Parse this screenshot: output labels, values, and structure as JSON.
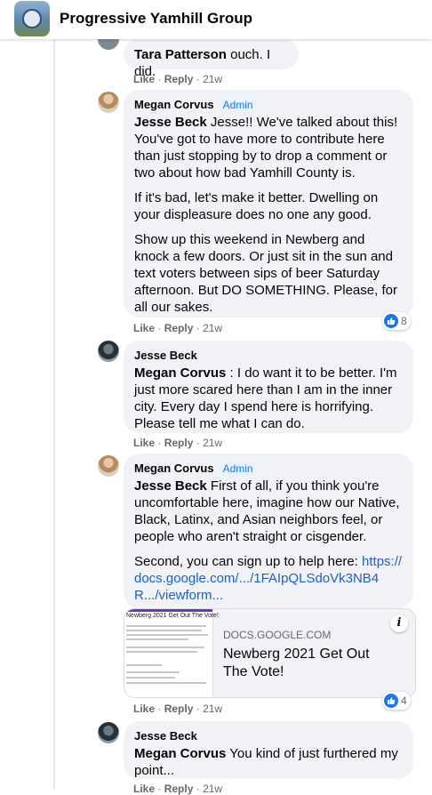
{
  "header": {
    "group_name": "Progressive Yamhill Group"
  },
  "action_labels": {
    "like": "Like",
    "reply": "Reply",
    "separator": "·"
  },
  "comments": [
    {
      "author": "Tara Patterson",
      "text": "ouch. I did.",
      "time": "21w"
    },
    {
      "author": "Megan Corvus",
      "badge": "Admin",
      "mention": "Jesse Beck",
      "paragraphs": [
        "Jesse!! We've talked about this! You've got to have more to contribute here than just stopping by to drop a comment or two about how bad Yamhill County is.",
        "If it's bad, let's make it better. Dwelling on your displeasure does no one any good.",
        "Show up this weekend in Newberg and knock a few doors. Or just sit in the sun and text voters between sips of beer Saturday afternoon. But DO SOMETHING. Please, for all our sakes."
      ],
      "time": "21w",
      "reactions": "8"
    },
    {
      "author": "Jesse Beck",
      "mention": "Megan Corvus",
      "text": ": I do want it to be better. I'm just more scared here than I am in the inner city. Every day I spend here is horrifying. Please tell me what I can do.",
      "time": "21w"
    },
    {
      "author": "Megan Corvus",
      "badge": "Admin",
      "mention": "Jesse Beck",
      "paragraph1": "First of all, if you think you're uncomfortable here, imagine how our Native, Black, Latinx, and Asian neighbors feel, or people who aren't straight or cisgender.",
      "paragraph2": "Second, you can sign up to help here:",
      "link": "https://docs.google.com/.../1FAIpQLSdoVk3NB4R.../viewform...",
      "card": {
        "domain": "DOCS.GOOGLE.COM",
        "title": "Newberg 2021 Get Out The Vote!",
        "thumb_title": "Newberg 2021 Get Out The Vote!"
      },
      "time": "21w",
      "reactions": "4"
    },
    {
      "author": "Jesse Beck",
      "mention": "Megan Corvus",
      "text": "You kind of just furthered my point...",
      "time": "21w"
    }
  ],
  "colors": {
    "accent": "#1877f2",
    "link": "#1a62c9",
    "bubble": "#f0f2f5",
    "meta": "#65676b"
  },
  "icons": {
    "like": "thumbs-up-icon",
    "info": "info-icon"
  }
}
